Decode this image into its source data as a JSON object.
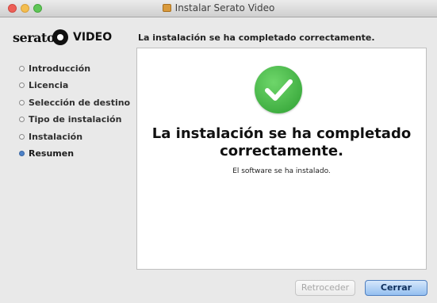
{
  "window": {
    "title": "Instalar Serato Video"
  },
  "brand": {
    "name": "serato",
    "product": "VIDEO"
  },
  "header": {
    "text": "La instalación se ha completado correctamente."
  },
  "steps": [
    {
      "label": "Introducción",
      "active": false
    },
    {
      "label": "Licencia",
      "active": false
    },
    {
      "label": "Selección de destino",
      "active": false
    },
    {
      "label": "Tipo de instalación",
      "active": false
    },
    {
      "label": "Instalación",
      "active": false
    },
    {
      "label": "Resumen",
      "active": true
    }
  ],
  "main": {
    "status_icon": "checkmark-icon",
    "message_line1": "La instalación se ha completado",
    "message_line2": "correctamente.",
    "submessage": "El software se ha instalado."
  },
  "buttons": {
    "back": "Retroceder",
    "close": "Cerrar"
  },
  "colors": {
    "accent": "#4d82c8",
    "success": "#3cb043"
  }
}
